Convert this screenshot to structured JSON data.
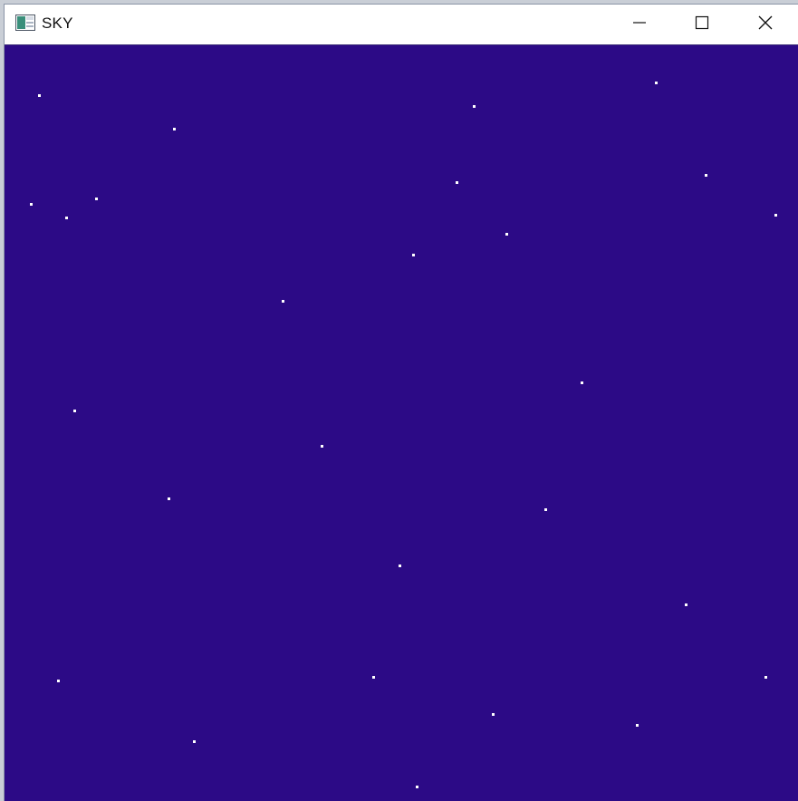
{
  "window": {
    "title": "SKY",
    "app_icon": "app-window-icon"
  },
  "controls": {
    "minimize_icon": "minimize-icon",
    "maximize_icon": "maximize-icon",
    "close_icon": "close-icon"
  },
  "colors": {
    "sky": "#2c0a86",
    "star": "#ffffff"
  },
  "sky": {
    "star_count": 28
  }
}
